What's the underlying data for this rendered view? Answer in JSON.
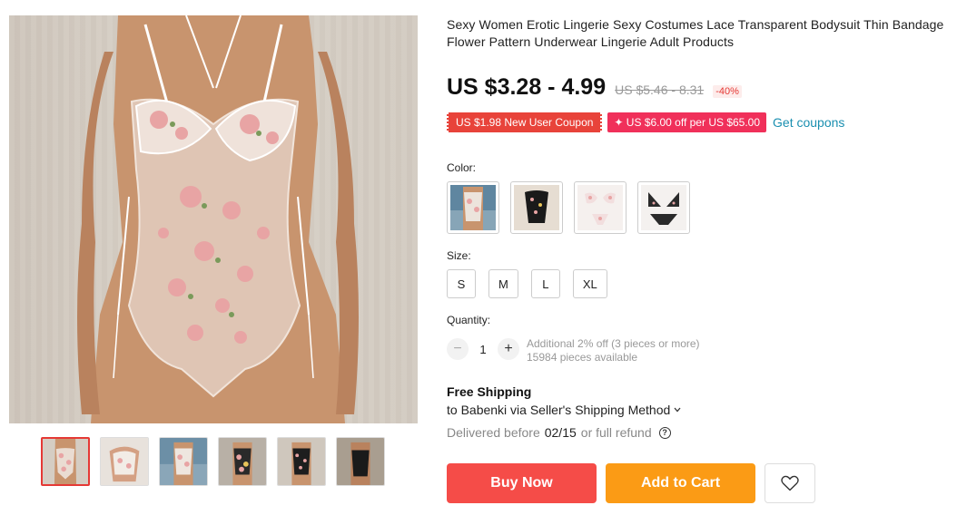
{
  "product": {
    "title": "Sexy Women Erotic Lingerie Sexy Costumes Lace Transparent Bodysuit Thin Bandage Flower Pattern Underwear Lingerie Adult Products"
  },
  "price": {
    "current": "US $3.28 - 4.99",
    "original": "US $5.46 - 8.31",
    "discount": "-40%"
  },
  "coupons": {
    "new_user": "US $1.98 New User Coupon",
    "store": "✦ US $6.00 off per US $65.00",
    "get_coupons": "Get coupons"
  },
  "color": {
    "label": "Color:",
    "options": [
      {
        "icon": "bodysuit-blue-swatch"
      },
      {
        "icon": "bodysuit-black-floral-swatch"
      },
      {
        "icon": "lingerie-set-pink-swatch"
      },
      {
        "icon": "lingerie-set-black-swatch"
      }
    ]
  },
  "size": {
    "label": "Size:",
    "options": [
      "S",
      "M",
      "L",
      "XL"
    ]
  },
  "quantity": {
    "label": "Quantity:",
    "value": "1",
    "discount_note": "Additional 2% off (3 pieces or more)",
    "available": "15984 pieces available"
  },
  "shipping": {
    "title": "Free Shipping",
    "destination": "to Babenki via Seller's Shipping Method",
    "delivered_prefix": "Delivered before",
    "delivered_date": "02/15",
    "delivered_suffix": "or full refund"
  },
  "actions": {
    "buy_now": "Buy Now",
    "add_to_cart": "Add to Cart"
  },
  "colors": {
    "buy": "#f54c48",
    "cart": "#fb9b15",
    "coupon_red": "#e8433a",
    "coupon_pink": "#f0305a",
    "link": "#1a8fb0"
  }
}
